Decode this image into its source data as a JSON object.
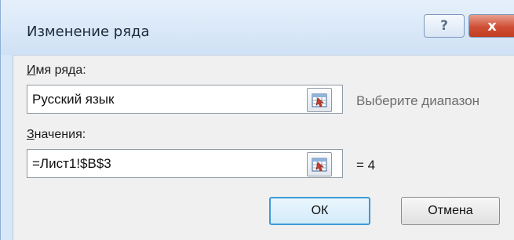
{
  "window": {
    "title": "Изменение ряда",
    "help_label": "?",
    "close_label": "x"
  },
  "series_name": {
    "label_accel": "И",
    "label_rest": "мя ряда:",
    "value": "Русский язык",
    "hint": "Выберите диапазон"
  },
  "series_values": {
    "label_accel": "З",
    "label_rest": "начения:",
    "value": "=Лист1!$B$3",
    "result": "= 4"
  },
  "buttons": {
    "ok_label": "ОК",
    "cancel_label": "Отмена"
  },
  "colors": {
    "frame": "#d8e8f8",
    "close": "#c9442a",
    "ok_border": "#3c9ad8"
  },
  "icons": [
    "help-icon",
    "close-icon",
    "range-picker-icon"
  ]
}
